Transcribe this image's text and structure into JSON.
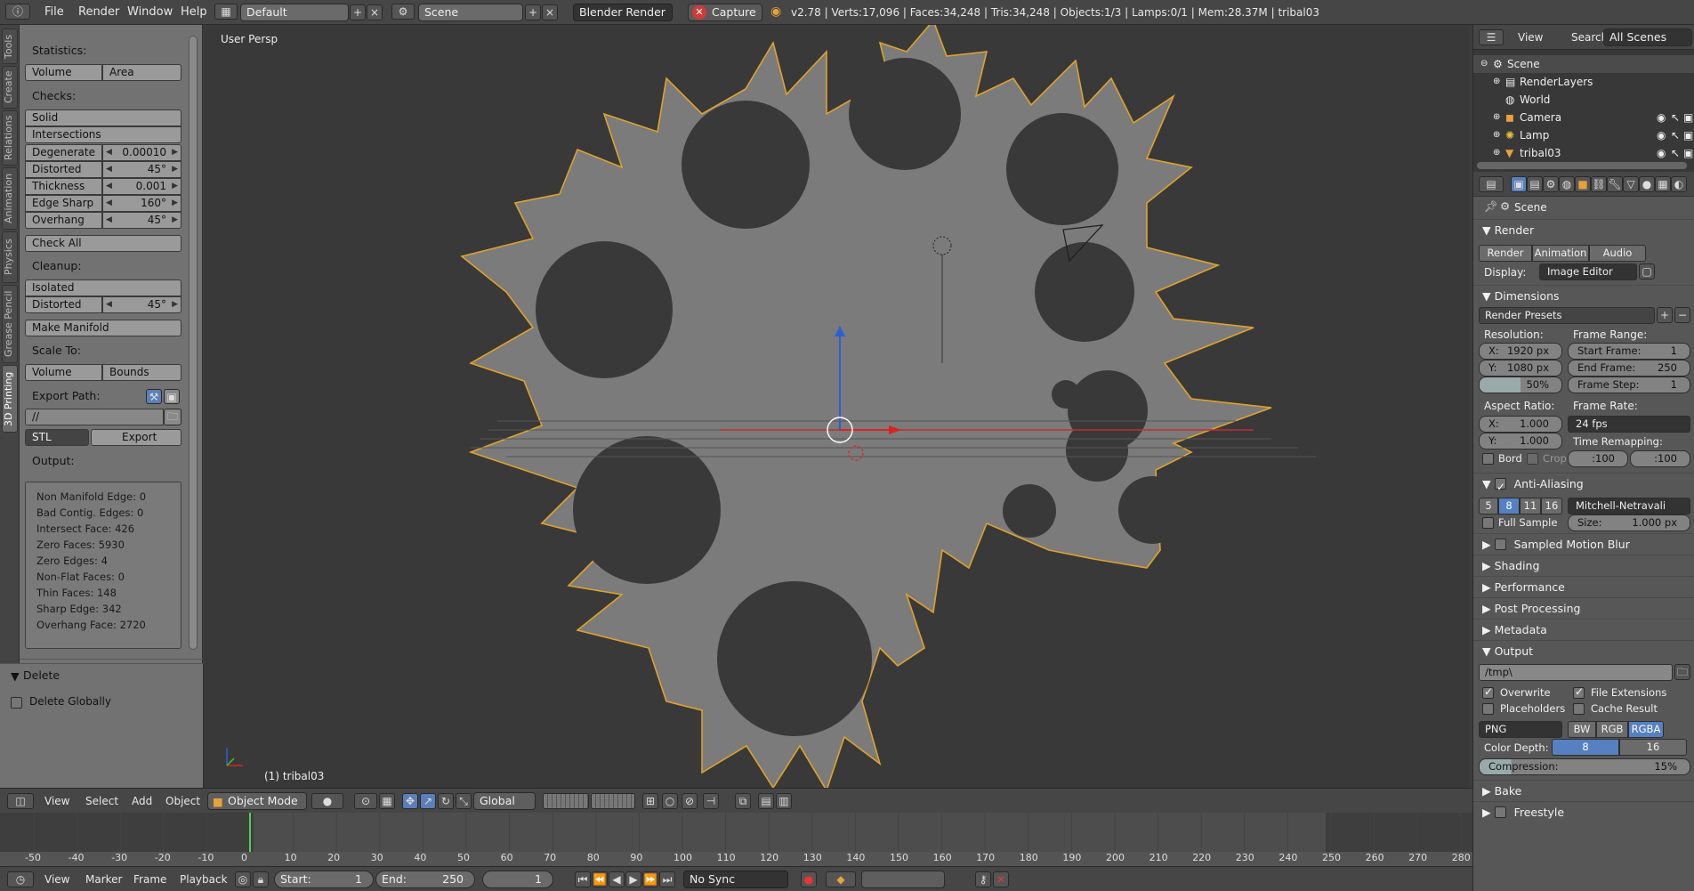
{
  "topbar": {
    "menus": [
      "File",
      "Render",
      "Window",
      "Help"
    ],
    "layout": "Default",
    "scene": "Scene",
    "engine": "Blender Render",
    "capture": "Capture",
    "stats": "v2.78 | Verts:17,096 | Faces:34,248 | Tris:34,248 | Objects:1/3 | Lamps:0/1 | Mem:28.37M | tribal03"
  },
  "lefttabs": [
    "Tools",
    "Create",
    "Relations",
    "Animation",
    "Physics",
    "Grease Pencil",
    "3D Printing"
  ],
  "toolshelf": {
    "statistics_label": "Statistics:",
    "volume": "Volume",
    "area": "Area",
    "checks_label": "Checks:",
    "solid": "Solid",
    "intersections": "Intersections",
    "degenerate": {
      "label": "Degenerate",
      "value": "0.00010"
    },
    "distorted": {
      "label": "Distorted",
      "value": "45°"
    },
    "thickness": {
      "label": "Thickness",
      "value": "0.001"
    },
    "edge_sharp": {
      "label": "Edge Sharp",
      "value": "160°"
    },
    "overhang": {
      "label": "Overhang",
      "value": "45°"
    },
    "check_all": "Check All",
    "cleanup_label": "Cleanup:",
    "isolated": "Isolated",
    "distorted2": {
      "label": "Distorted",
      "value": "45°"
    },
    "make_manifold": "Make Manifold",
    "scale_to_label": "Scale To:",
    "volume2": "Volume",
    "bounds": "Bounds",
    "export_path_label": "Export Path:",
    "export_path": "//",
    "format": "STL",
    "export": "Export",
    "output_label": "Output:",
    "output_lines": [
      "Non Manifold Edge: 0",
      "Bad Contig. Edges: 0",
      "Intersect Face: 426",
      "Zero Faces: 5930",
      "Zero Edges: 4",
      "Non-Flat Faces: 0",
      "Thin Faces: 148",
      "Sharp Edge: 342",
      "Overhang Face: 2720"
    ],
    "delete_header": "Delete",
    "delete_globally": "Delete Globally"
  },
  "viewport": {
    "view_name": "User Persp",
    "object_label": "(1) tribal03"
  },
  "header3d": {
    "view": "View",
    "select": "Select",
    "add": "Add",
    "object": "Object",
    "mode": "Object Mode",
    "orientation": "Global"
  },
  "timeline": {
    "ticks": [
      "-50",
      "-40",
      "-30",
      "-20",
      "-10",
      "0",
      "10",
      "20",
      "30",
      "40",
      "50",
      "60",
      "70",
      "80",
      "90",
      "100",
      "110",
      "120",
      "130",
      "140",
      "150",
      "160",
      "170",
      "180",
      "190",
      "200",
      "210",
      "220",
      "230",
      "240",
      "250",
      "260",
      "270",
      "280"
    ],
    "current_frame": 0
  },
  "tlbar": {
    "view": "View",
    "marker": "Marker",
    "frame": "Frame",
    "playback": "Playback",
    "start": {
      "label": "Start:",
      "value": "1"
    },
    "end": {
      "label": "End:",
      "value": "250"
    },
    "current": "1",
    "sync": "No Sync"
  },
  "outliner": {
    "view": "View",
    "search": "Search",
    "scenes": "All Scenes",
    "rows": [
      "Scene",
      "RenderLayers",
      "World",
      "Camera",
      "Lamp",
      "tribal03"
    ]
  },
  "props": {
    "context": "Scene",
    "render_header": "Render",
    "render_btn": "Render",
    "animation_btn": "Animation",
    "audio_btn": "Audio",
    "display_label": "Display:",
    "display_value": "Image Editor",
    "dimensions_header": "Dimensions",
    "presets": "Render Presets",
    "resolution_label": "Resolution:",
    "res_x": {
      "label": "X:",
      "value": "1920 px"
    },
    "res_y": {
      "label": "Y:",
      "value": "1080 px"
    },
    "res_pct": "50%",
    "frame_range_label": "Frame Range:",
    "start_frame": {
      "label": "Start Frame:",
      "value": "1"
    },
    "end_frame": {
      "label": "End Frame:",
      "value": "250"
    },
    "frame_step": {
      "label": "Frame Step:",
      "value": "1"
    },
    "aspect_label": "Aspect Ratio:",
    "asp_x": {
      "label": "X:",
      "value": "1.000"
    },
    "asp_y": {
      "label": "Y:",
      "value": "1.000"
    },
    "frame_rate_label": "Frame Rate:",
    "fps": "24 fps",
    "time_remap_label": "Time Remapping:",
    "remap_old": ":100",
    "remap_new": ":100",
    "bord": "Bord",
    "crop": "Crop",
    "aa_header": "Anti-Aliasing",
    "aa_samples": [
      "5",
      "8",
      "11",
      "16"
    ],
    "aa_filter": "Mitchell-Netravali",
    "full_sample": "Full Sample",
    "size": {
      "label": "Size:",
      "value": "1.000 px"
    },
    "sampled_motion_blur": "Sampled Motion Blur",
    "shading": "Shading",
    "performance": "Performance",
    "post_processing": "Post Processing",
    "metadata": "Metadata",
    "output_header": "Output",
    "output_path": "/tmp\\",
    "overwrite": "Overwrite",
    "file_extensions": "File Extensions",
    "placeholders": "Placeholders",
    "cache_result": "Cache Result",
    "file_format": "PNG",
    "bw": "BW",
    "rgb": "RGB",
    "rgba": "RGBA",
    "color_depth_label": "Color Depth:",
    "depth8": "8",
    "depth16": "16",
    "compression": {
      "label": "Compression:",
      "value": "15%"
    },
    "bake": "Bake",
    "freestyle": "Freestyle"
  }
}
